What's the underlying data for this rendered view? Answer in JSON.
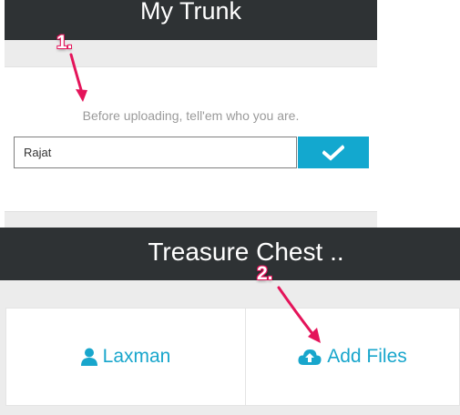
{
  "panel1": {
    "title": "My Trunk",
    "hint": "Before uploading, tell'em who you are.",
    "name_value": "Rajat",
    "submit_icon": "checkmark-icon"
  },
  "panel2": {
    "title": "Treasure Chest ..",
    "user_label": "Laxman",
    "user_icon": "user-icon",
    "add_files_label": "Add Files",
    "add_files_icon": "cloud-upload-icon"
  },
  "annotations": {
    "step1": "1.",
    "step2": "2."
  },
  "colors": {
    "header_bg": "#2e3234",
    "accent": "#13a8cf",
    "annotation": "#e4145a",
    "panel_gray": "#ececec"
  }
}
